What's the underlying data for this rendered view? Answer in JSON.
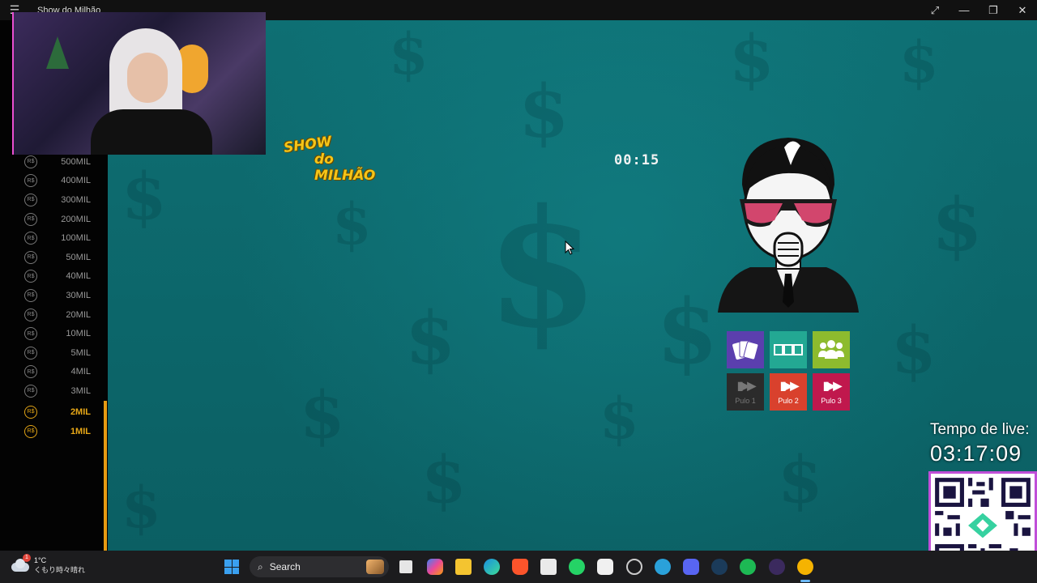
{
  "window": {
    "title": "Show do Milhão",
    "menu_icon": "hamburger-icon",
    "controls": [
      "expand-icon",
      "minimize-icon",
      "restore-icon",
      "close-icon"
    ]
  },
  "game": {
    "logo": {
      "line1": "SHOW",
      "line2": "do MILHÃO",
      "script": "do"
    },
    "timer": "00:15",
    "prize_ladder": [
      {
        "amount": "500MIL",
        "reached": false
      },
      {
        "amount": "400MIL",
        "reached": false
      },
      {
        "amount": "300MIL",
        "reached": false
      },
      {
        "amount": "200MIL",
        "reached": false
      },
      {
        "amount": "100MIL",
        "reached": false
      },
      {
        "amount": "50MIL",
        "reached": false
      },
      {
        "amount": "40MIL",
        "reached": false
      },
      {
        "amount": "30MIL",
        "reached": false
      },
      {
        "amount": "20MIL",
        "reached": false
      },
      {
        "amount": "10MIL",
        "reached": false
      },
      {
        "amount": "5MIL",
        "reached": false
      },
      {
        "amount": "4MIL",
        "reached": false
      },
      {
        "amount": "3MIL",
        "reached": false
      },
      {
        "amount": "2MIL",
        "reached": true
      },
      {
        "amount": "1MIL",
        "reached": true
      }
    ],
    "coin_symbol": "R$",
    "lifelines": [
      {
        "name": "cards",
        "icon": "cards-icon",
        "color": "#5b3fae"
      },
      {
        "name": "plaques",
        "icon": "plaques-icon",
        "color": "#23a893"
      },
      {
        "name": "audience",
        "icon": "audience-icon",
        "color": "#8dbb2e"
      }
    ],
    "skips": [
      {
        "label": "Pulo 1",
        "color": "#2b2b2b",
        "text_color": "#777777",
        "used": true
      },
      {
        "label": "Pulo 2",
        "color": "#d9412d",
        "text_color": "#ffffff",
        "used": false
      },
      {
        "label": "Pulo 3",
        "color": "#c0184d",
        "text_color": "#ffffff",
        "used": false
      }
    ]
  },
  "overlay": {
    "live_label": "Tempo de live:",
    "live_time": "03:17:09"
  },
  "taskbar": {
    "weather_temp": "1°C",
    "weather_desc": "くもり時々晴れ",
    "weather_badge": "1",
    "search_label": "Search"
  }
}
